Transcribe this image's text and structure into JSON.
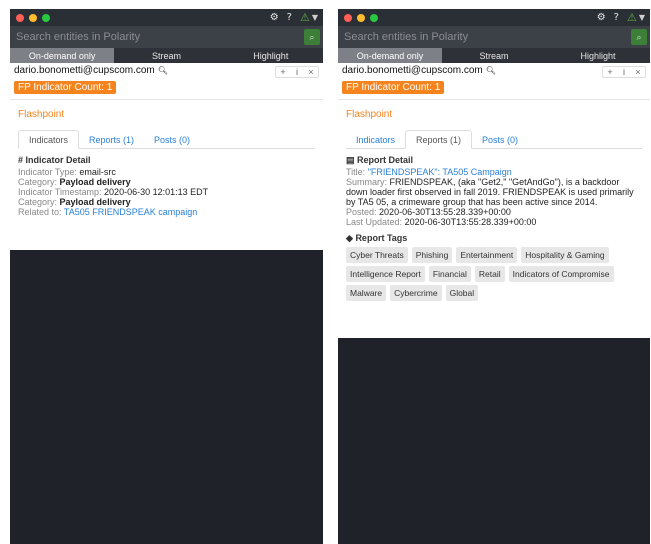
{
  "colors": {
    "panel_bg": "#1f2329",
    "accent_orange": "#f5841f",
    "link_blue": "#2a7fd4",
    "search_green": "#3d7f39",
    "warning_green": "#5cb545"
  },
  "icons": {
    "settings": "gear-icon",
    "help": "question-icon",
    "warning": "warning-triangle-icon",
    "dropdown": "chevron-down-icon",
    "search": "search-icon",
    "lookup": "magnifier-icon",
    "add": "plus-icon",
    "info": "info-icon",
    "close": "close-icon",
    "indicator": "hashtag-icon",
    "report": "newspaper-icon",
    "tags": "tag-icon"
  },
  "left": {
    "search": {
      "placeholder": "Search entities in Polarity"
    },
    "modes": [
      {
        "label": "On-demand only",
        "active": true
      },
      {
        "label": "Stream",
        "active": false
      },
      {
        "label": "Highlight",
        "active": false
      }
    ],
    "entity": {
      "email": "dario.bonomet​ti@cupscom.com"
    },
    "controls": {
      "add": "+",
      "info": "i",
      "close": "×"
    },
    "badge": "FP Indicator Count: 1",
    "integration": "Flashpoint",
    "tabs": [
      "Indicators",
      "Reports (1)",
      "Posts (0)"
    ],
    "detail": {
      "heading": "Indicator Detail",
      "type_label": "Indicator Type:",
      "type_value": "email-src",
      "cat1_label": "Category:",
      "cat1_value": "Payload delivery",
      "ts_label": "Indicator Timestamp:",
      "ts_value": "2020-06-30 12:01:13 EDT",
      "cat2_label": "Category:",
      "cat2_value": "Payload delivery",
      "related_label": "Related to:",
      "related_value": "TA505 FRIENDSPEAK campaign"
    }
  },
  "right": {
    "search": {
      "placeholder": "Search entities in Polarity"
    },
    "modes": [
      {
        "label": "On-demand only",
        "active": true
      },
      {
        "label": "Stream",
        "active": false
      },
      {
        "label": "Highlight",
        "active": false
      }
    ],
    "entity": {
      "email": "dario.bonometti@cupscom.com"
    },
    "controls": {
      "add": "+",
      "info": "i",
      "close": "×"
    },
    "badge": "FP Indicator Count: 1",
    "integration": "Flashpoint",
    "tabs": [
      "Indicators",
      "Reports (1)",
      "Posts (0)"
    ],
    "report": {
      "heading": "Report Detail",
      "title_label": "Title:",
      "title_value": "\"FRIENDSPEAK\": TA505 Campaign",
      "summary_label": "Summary:",
      "summary_value": "FRIENDSPEAK, (aka \"Get2,\" \"GetAndGo\"), is a backdoor down loader first observed in fall 2019. FRIENDSPEAK is used primarily by TA5 05, a crimeware group that has been active since 2014.",
      "posted_label": "Posted:",
      "posted_value": "2020-06-30T13:55:28.339+00:00",
      "updated_label": "Last Updated:",
      "updated_value": "2020-06-30T13:55:28.339+00:00",
      "tags_heading": "Report Tags",
      "tags": [
        "Cyber Threats",
        "Phishing",
        "Entertainment",
        "Hospitality & Gaming",
        "Intelligence Report",
        "Financial",
        "Retail",
        "Indicators of Compromise",
        "Malware",
        "Cybercrime",
        "Global"
      ]
    }
  }
}
